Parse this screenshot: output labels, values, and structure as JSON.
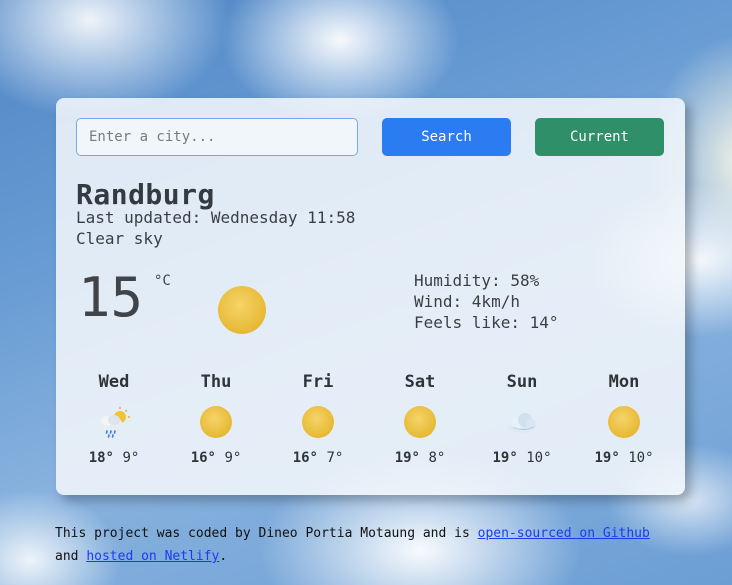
{
  "search": {
    "placeholder": "Enter a city...",
    "button_label": "Search"
  },
  "current_button_label": "Current",
  "weather": {
    "city": "Randburg",
    "last_updated": "Last updated: Wednesday 11:58",
    "description": "Clear sky",
    "temperature": "15",
    "unit": "°C",
    "icon": "sun-icon",
    "humidity": "Humidity: 58%",
    "wind": "Wind: 4km/h",
    "feels_like": "Feels like: 14°"
  },
  "forecast": [
    {
      "day": "Wed",
      "icon": "rain-sun-cloud-icon",
      "max": "18°",
      "min": "9°"
    },
    {
      "day": "Thu",
      "icon": "sun-icon",
      "max": "16°",
      "min": "9°"
    },
    {
      "day": "Fri",
      "icon": "sun-icon",
      "max": "16°",
      "min": "7°"
    },
    {
      "day": "Sat",
      "icon": "sun-icon",
      "max": "19°",
      "min": "8°"
    },
    {
      "day": "Sun",
      "icon": "cloud-icon",
      "max": "19°",
      "min": "10°"
    },
    {
      "day": "Mon",
      "icon": "sun-icon",
      "max": "19°",
      "min": "10°"
    }
  ],
  "footer": {
    "text_before": "This project was coded by Dineo Portia Motaung and is ",
    "link1": "open-sourced on Github",
    "text_middle": " and ",
    "link2": "hosted on Netlify",
    "text_after": "."
  },
  "colors": {
    "search_button": "#2b7bf1",
    "current_button": "#2e8f68",
    "link": "#1a3cf0"
  }
}
